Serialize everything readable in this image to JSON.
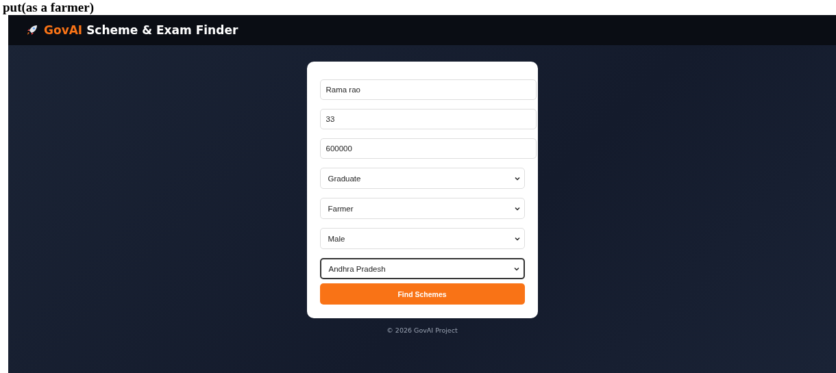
{
  "caption": "put(as a farmer)",
  "header": {
    "brand": "GovAI",
    "title": "Scheme & Exam Finder"
  },
  "form": {
    "fields": [
      {
        "kind": "input",
        "value": "Rama rao",
        "focused": false
      },
      {
        "kind": "input",
        "value": "33",
        "focused": false
      },
      {
        "kind": "input",
        "value": "600000",
        "focused": false
      },
      {
        "kind": "select",
        "value": "Graduate",
        "focused": false
      },
      {
        "kind": "select",
        "value": "Farmer",
        "focused": false
      },
      {
        "kind": "select",
        "value": "Male",
        "focused": false
      },
      {
        "kind": "select",
        "value": "Andhra Pradesh",
        "focused": true
      }
    ],
    "submit": "Find Schemes"
  },
  "footer": "© 2026 GovAI Project"
}
